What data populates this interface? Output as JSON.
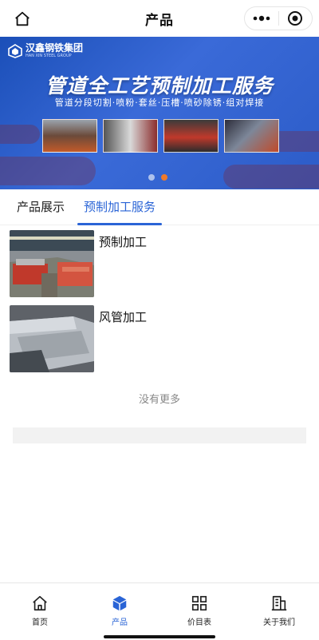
{
  "header": {
    "title": "产品"
  },
  "banner": {
    "brand_name": "汉鑫钢铁集团",
    "brand_sub": "HAN XIN STEEL GROUP",
    "headline": "管道全工艺预制加工服务",
    "subline": "管道分段切割·喷粉·套丝·压槽·喷砂除锈·组对焊接",
    "slide_index": 2,
    "slide_count": 2
  },
  "tabs": [
    {
      "label": "产品展示",
      "active": false
    },
    {
      "label": "预制加工服务",
      "active": true
    }
  ],
  "products": [
    {
      "title": "预制加工"
    },
    {
      "title": "风管加工"
    }
  ],
  "list_footer": "没有更多",
  "tabbar": [
    {
      "label": "首页",
      "icon": "home-icon",
      "active": false
    },
    {
      "label": "产品",
      "icon": "cube-icon",
      "active": true
    },
    {
      "label": "价目表",
      "icon": "grid-icon",
      "active": false
    },
    {
      "label": "关于我们",
      "icon": "building-icon",
      "active": false
    }
  ],
  "colors": {
    "accent": "#2a64d6",
    "banner": "#2c5cc8",
    "indicator": "#f07a2b"
  }
}
